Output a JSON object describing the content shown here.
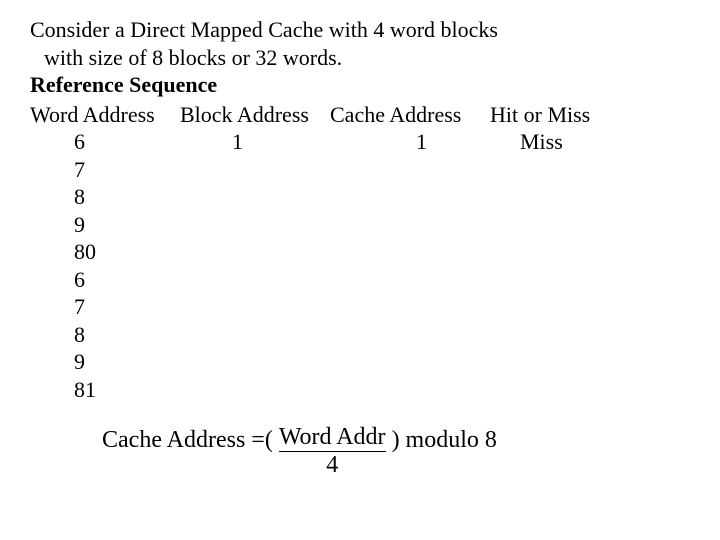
{
  "intro": {
    "line1": "Consider a Direct Mapped Cache with 4 word blocks",
    "line2": "with size of 8 blocks or 32 words.",
    "heading": "Reference Sequence"
  },
  "headers": {
    "word": "Word Address",
    "block": "Block Address",
    "cache": "Cache Address",
    "hit": "Hit or Miss"
  },
  "rows": [
    {
      "word": "6",
      "block": "1",
      "cache": "1",
      "hit": "Miss"
    },
    {
      "word": "7",
      "block": "",
      "cache": "",
      "hit": ""
    },
    {
      "word": "8",
      "block": "",
      "cache": "",
      "hit": ""
    },
    {
      "word": "9",
      "block": "",
      "cache": "",
      "hit": ""
    },
    {
      "word": "80",
      "block": "",
      "cache": "",
      "hit": ""
    },
    {
      "word": "6",
      "block": "",
      "cache": "",
      "hit": ""
    },
    {
      "word": "7",
      "block": "",
      "cache": "",
      "hit": ""
    },
    {
      "word": "8",
      "block": "",
      "cache": "",
      "hit": ""
    },
    {
      "word": "9",
      "block": "",
      "cache": "",
      "hit": ""
    },
    {
      "word": "81",
      "block": "",
      "cache": "",
      "hit": ""
    }
  ],
  "formula": {
    "left": "Cache Address =( ",
    "num": "Word Addr",
    "den": "4",
    "right": " ) modulo 8"
  }
}
